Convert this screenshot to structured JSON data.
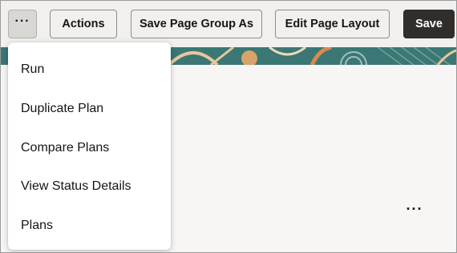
{
  "toolbar": {
    "more_label": "···",
    "actions_label": "Actions",
    "save_page_group_as_label": "Save Page Group As",
    "edit_page_layout_label": "Edit Page Layout",
    "save_label": "Save"
  },
  "menu": {
    "items": [
      {
        "label": "Run"
      },
      {
        "label": "Duplicate Plan"
      },
      {
        "label": "Compare Plans"
      },
      {
        "label": "View Status Details"
      },
      {
        "label": "Plans"
      }
    ]
  },
  "content": {
    "more_label": "···"
  },
  "colors": {
    "save_button": "#312d2a",
    "more_button_active": "#d9d7d3",
    "banner_teal": "#2f6b6b",
    "banner_orange": "#d98a4e",
    "banner_tan": "#e8c79a"
  },
  "icons": {
    "more": "horizontal-ellipsis",
    "content_more": "horizontal-ellipsis"
  }
}
